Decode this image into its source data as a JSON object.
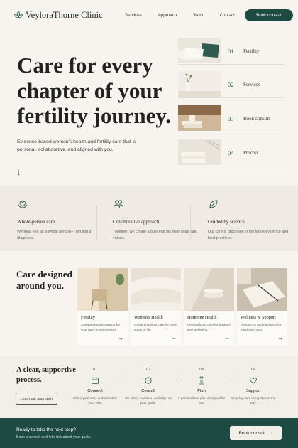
{
  "header": {
    "logo_text": "VeyloraThorne Clinic",
    "nav": [
      "Services",
      "Approach",
      "Work",
      "Contact"
    ],
    "cta": "Book consult"
  },
  "hero": {
    "title": "Care for every chapter of your fertility journey.",
    "subtitle": "Evidence-based women's health and fertility care that is personal, collaborative, and aligned with you."
  },
  "side_list": [
    {
      "num": "01",
      "label": "Fertility"
    },
    {
      "num": "02",
      "label": "Services"
    },
    {
      "num": "03",
      "label": "Book consult"
    },
    {
      "num": "04",
      "label": "Process"
    }
  ],
  "features": [
    {
      "title": "Whole-person care",
      "desc": "We treat you as a whole person— not just a diagnosis.",
      "icon": "heart-hands-icon"
    },
    {
      "title": "Collaborative approach",
      "desc": "Together, we create a plan that fits your goals and values.",
      "icon": "people-icon"
    },
    {
      "title": "Guided by science",
      "desc": "Our care is grounded in the latest evidence and best practices.",
      "icon": "leaf-icon"
    }
  ],
  "care": {
    "title": "Care designed around you.",
    "cards": [
      {
        "title": "Fertility",
        "desc": "Compassionate support for your path to parenthood."
      },
      {
        "title": "Women's Health",
        "desc": "Comprehensive care for every stage of life."
      },
      {
        "title": "Hormone Health",
        "desc": "Personalized care for balance and wellbeing."
      },
      {
        "title": "Wellness & Support",
        "desc": "Resources and guidance for mind and body."
      }
    ]
  },
  "process": {
    "title": "A clear, supportive process.",
    "button": "Learn our approach",
    "steps": [
      {
        "num": "01",
        "title": "Connect",
        "desc": "Share your story and schedule your visit."
      },
      {
        "num": "02",
        "title": "Consult",
        "desc": "We listen, evaluate, and align on your goals."
      },
      {
        "num": "03",
        "title": "Plan",
        "desc": "A personalized plan designed for you."
      },
      {
        "num": "04",
        "title": "Support",
        "desc": "Ongoing care every step of the way."
      }
    ]
  },
  "footer": {
    "title": "Ready to take the next step?",
    "subtitle": "Book a consult and let's talk about your goals.",
    "button": "Book consult"
  },
  "colors": {
    "accent": "#1d4a42",
    "background": "#f7f4ef"
  }
}
